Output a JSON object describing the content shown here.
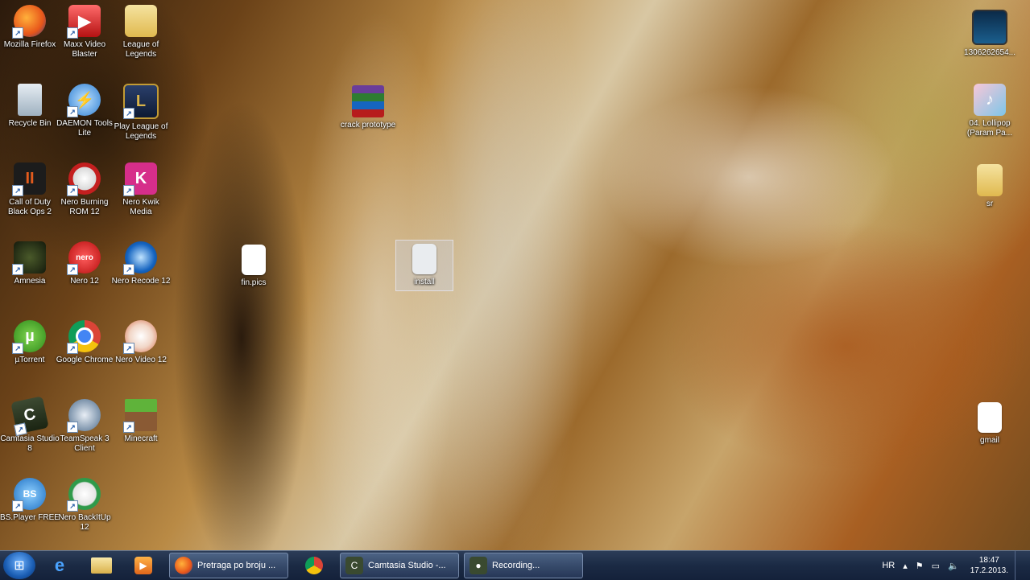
{
  "desktop": {
    "icons": [
      {
        "label": "Mozilla Firefox",
        "icon": "firefox-icon"
      },
      {
        "label": "Maxx Video Blaster",
        "icon": "video-icon"
      },
      {
        "label": "League of Legends",
        "icon": "folder-icon"
      },
      {
        "label": "Recycle Bin",
        "icon": "recycle-bin-icon"
      },
      {
        "label": "DAEMON Tools Lite",
        "icon": "daemon-tools-icon"
      },
      {
        "label": "Play League of Legends",
        "icon": "league-icon"
      },
      {
        "label": "Call of Duty Black Ops 2",
        "icon": "game-icon"
      },
      {
        "label": "Nero Burning ROM 12",
        "icon": "nero-icon"
      },
      {
        "label": "Nero Kwik Media",
        "icon": "kwik-icon"
      },
      {
        "label": "Amnesia",
        "icon": "amnesia-icon"
      },
      {
        "label": "Nero 12",
        "icon": "nero-icon"
      },
      {
        "label": "Nero Recode 12",
        "icon": "recode-icon"
      },
      {
        "label": "µTorrent",
        "icon": "utorrent-icon"
      },
      {
        "label": "Google Chrome",
        "icon": "chrome-icon"
      },
      {
        "label": "Nero Video 12",
        "icon": "nero-video-icon"
      },
      {
        "label": "Camtasia Studio 8",
        "icon": "camtasia-icon"
      },
      {
        "label": "TeamSpeak 3 Client",
        "icon": "teamspeak-icon"
      },
      {
        "label": "Minecraft",
        "icon": "minecraft-icon"
      },
      {
        "label": "BS.Player FREE",
        "icon": "bsplayer-icon"
      },
      {
        "label": "Nero BackItUp 12",
        "icon": "backitup-icon"
      },
      {
        "label": "crack prototype",
        "icon": "archive-icon"
      },
      {
        "label": "fin.pics",
        "icon": "file-icon"
      },
      {
        "label": "install",
        "icon": "file-icon"
      },
      {
        "label": "1306262654...",
        "icon": "video-thumb-icon"
      },
      {
        "label": "04. Lollipop (Param Pa...",
        "icon": "music-icon"
      },
      {
        "label": "sr",
        "icon": "folder-icon"
      },
      {
        "label": "gmail",
        "icon": "file-icon"
      }
    ]
  },
  "taskbar": {
    "tasks": [
      {
        "label": "Pretraga po broju ...",
        "icon": "firefox-icon"
      },
      {
        "label": "Camtasia Studio -...",
        "icon": "camtasia-icon"
      },
      {
        "label": "Recording...",
        "icon": "recorder-icon"
      }
    ],
    "language": "HR",
    "time": "18:47",
    "date": "17.2.2013."
  }
}
